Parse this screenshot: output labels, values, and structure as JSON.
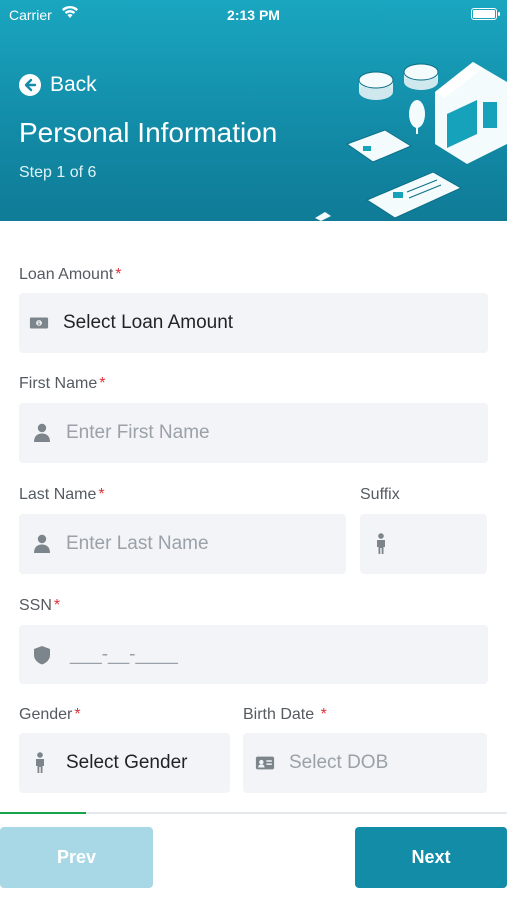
{
  "status_bar": {
    "carrier": "Carrier",
    "time": "2:13 PM"
  },
  "header": {
    "back_label": "Back",
    "title": "Personal Information",
    "step": "Step 1 of 6"
  },
  "form": {
    "loan_amount": {
      "label": "Loan Amount",
      "value": "Select Loan Amount",
      "icon": "money-icon"
    },
    "first_name": {
      "label": "First Name",
      "placeholder": "Enter First Name",
      "icon": "person-icon"
    },
    "last_name": {
      "label": "Last Name",
      "placeholder": "Enter Last Name",
      "icon": "person-icon"
    },
    "suffix": {
      "label": "Suffix",
      "icon": "person-standing-icon"
    },
    "ssn": {
      "label": "SSN",
      "placeholder": "___-__-____",
      "icon": "shield-icon"
    },
    "gender": {
      "label": "Gender",
      "value": "Select Gender",
      "icon": "person-standing-icon"
    },
    "birth_date": {
      "label": "Birth Date",
      "placeholder": "Select DOB",
      "icon": "id-card-icon"
    },
    "required_mark": "*"
  },
  "progress": {
    "fraction": 0.17
  },
  "buttons": {
    "prev": "Prev",
    "next": "Next"
  },
  "colors": {
    "header": "#128aa6",
    "accent": "#138ca8",
    "required": "#e0303a",
    "progress": "#16a34a"
  }
}
